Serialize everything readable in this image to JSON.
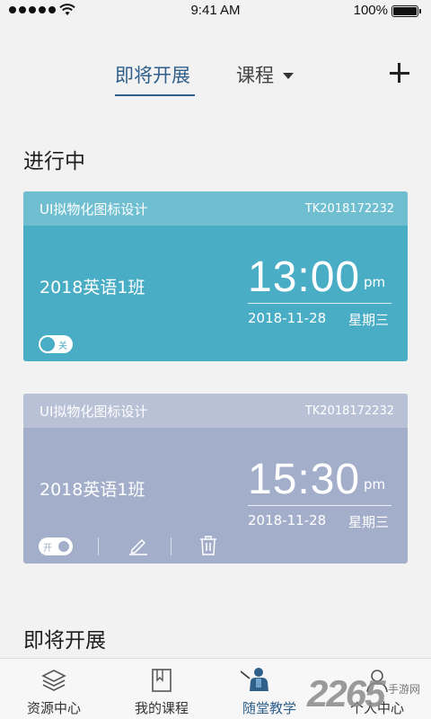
{
  "status_bar": {
    "time": "9:41 AM",
    "battery": "100%"
  },
  "header": {
    "tab_upcoming": "即将开展",
    "tab_course": "课程"
  },
  "sections": {
    "in_progress": "进行中",
    "upcoming": "即将开展"
  },
  "cards": [
    {
      "title": "UI拟物化图标设计",
      "code": "TK2018172232",
      "class_name": "2018英语1班",
      "time": "13:00",
      "ampm": "pm",
      "date": "2018-11-28",
      "weekday": "星期三",
      "toggle_label": "关",
      "bg_color": "#4aadc6"
    },
    {
      "title": "UI拟物化图标设计",
      "code": "TK2018172232",
      "class_name": "2018英语1班",
      "time": "15:30",
      "ampm": "pm",
      "date": "2018-11-28",
      "weekday": "星期三",
      "toggle_label": "开",
      "bg_color": "#a3afca"
    }
  ],
  "tabbar": [
    {
      "label": "资源中心",
      "icon": "layers-icon"
    },
    {
      "label": "我的课程",
      "icon": "book-icon"
    },
    {
      "label": "随堂教学",
      "icon": "teacher-icon",
      "active": true
    },
    {
      "label": "个人中心",
      "icon": "person-icon"
    }
  ],
  "watermark": {
    "number": "2265",
    "text": "手游网"
  },
  "colors": {
    "accent": "#2f5f8a",
    "card_active": "#4aadc6",
    "card_inactive": "#a3afca"
  }
}
